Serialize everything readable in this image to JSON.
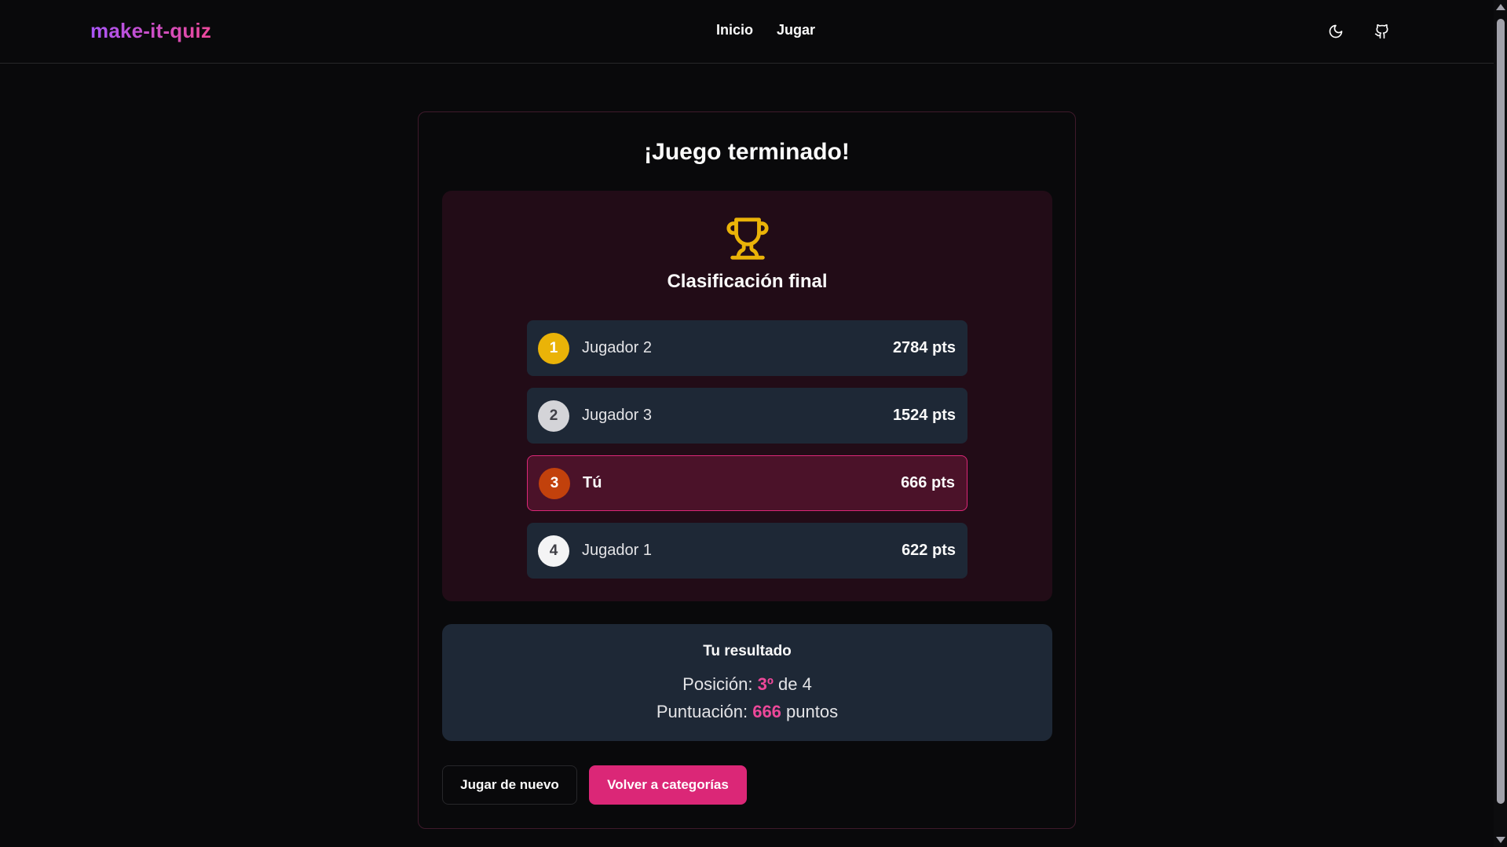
{
  "header": {
    "logo": "make-it-quiz",
    "nav": [
      {
        "label": "Inicio"
      },
      {
        "label": "Jugar"
      }
    ],
    "icons": {
      "theme": "moon-icon",
      "repo": "github-icon"
    }
  },
  "results": {
    "title": "¡Juego terminado!",
    "ranking_title": "Clasificación final",
    "trophy_icon": "trophy-icon",
    "players": [
      {
        "rank": "1",
        "name": "Jugador 2",
        "score": "2784 pts"
      },
      {
        "rank": "2",
        "name": "Jugador 3",
        "score": "1524 pts"
      },
      {
        "rank": "3",
        "name": "Tú",
        "score": "666 pts"
      },
      {
        "rank": "4",
        "name": "Jugador 1",
        "score": "622 pts"
      }
    ],
    "summary": {
      "title": "Tu resultado",
      "position_label": "Posición:",
      "position_value": "3º",
      "position_suffix": "de 4",
      "score_label": "Puntuación:",
      "score_value": "666",
      "score_suffix": "puntos"
    },
    "buttons": {
      "play_again": "Jugar de nuevo",
      "back_to_categories": "Volver a categorías"
    }
  },
  "colors": {
    "accent": "#db2777",
    "logo_gradient_start": "#a855f7",
    "logo_gradient_end": "#ec4899",
    "gold": "#eab308",
    "bronze": "#c2410c"
  }
}
